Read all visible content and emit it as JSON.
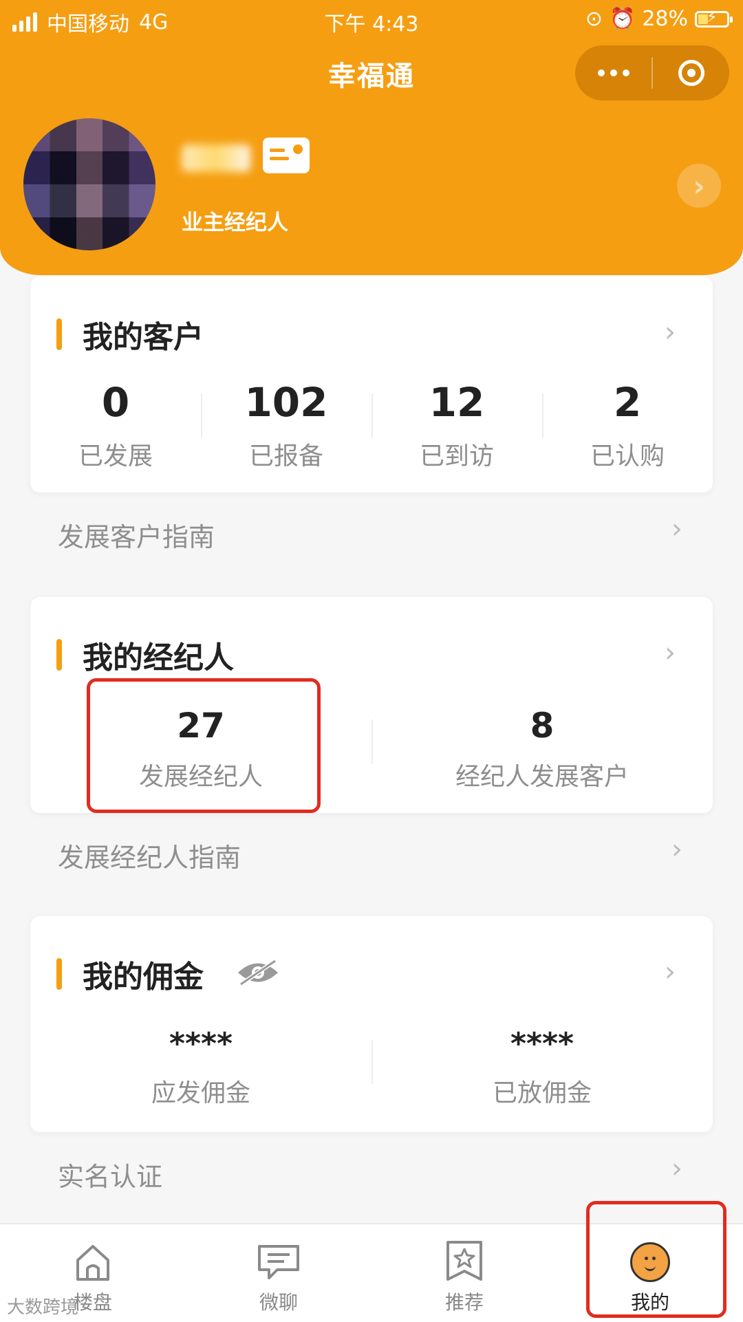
{
  "status_bar": {
    "carrier": "中国移动",
    "network": "4G",
    "time": "下午 4:43",
    "battery": "28%"
  },
  "nav": {
    "title": "幸福通"
  },
  "profile": {
    "role": "业主经纪人"
  },
  "customers_card": {
    "title": "我的客户",
    "stats": [
      {
        "value": "0",
        "label": "已发展"
      },
      {
        "value": "102",
        "label": "已报备"
      },
      {
        "value": "12",
        "label": "已到访"
      },
      {
        "value": "2",
        "label": "已认购"
      }
    ]
  },
  "customers_guide": "发展客户指南",
  "agents_card": {
    "title": "我的经纪人",
    "stats": [
      {
        "value": "27",
        "label": "发展经纪人"
      },
      {
        "value": "8",
        "label": "经纪人发展客户"
      }
    ]
  },
  "agents_guide": "发展经纪人指南",
  "commission_card": {
    "title": "我的佣金",
    "stats": [
      {
        "value": "****",
        "label": "应发佣金"
      },
      {
        "value": "****",
        "label": "已放佣金"
      }
    ]
  },
  "realname": "实名认证",
  "tabs": [
    {
      "label": "楼盘",
      "icon": "home-icon"
    },
    {
      "label": "微聊",
      "icon": "chat-icon"
    },
    {
      "label": "推荐",
      "icon": "star-icon"
    },
    {
      "label": "我的",
      "icon": "face-icon"
    }
  ],
  "watermark": "大数跨境",
  "colors": {
    "brand": "#f59e12",
    "highlight": "#e22b20"
  }
}
